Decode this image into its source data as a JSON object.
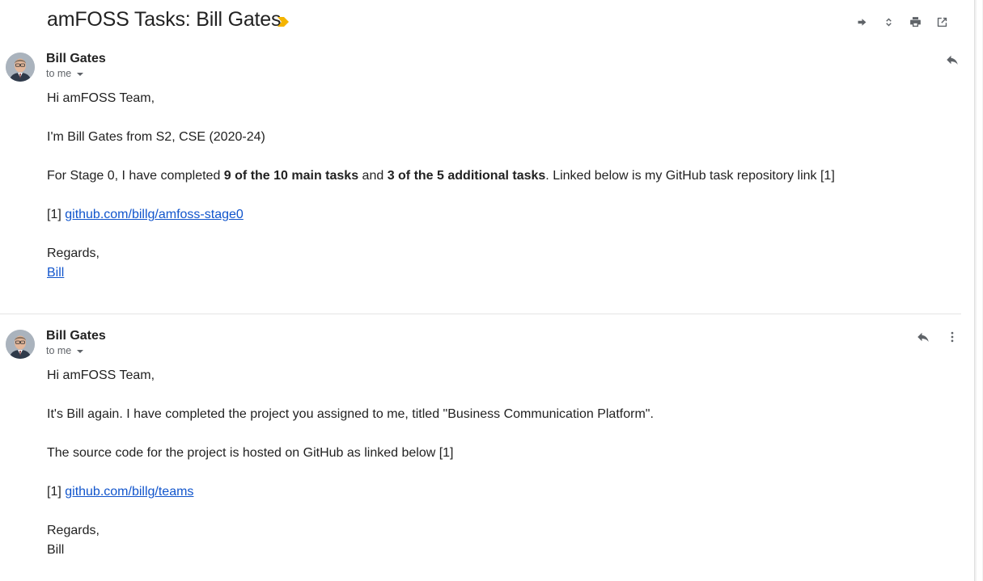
{
  "thread": {
    "subject": "amFOSS Tasks: Bill Gates",
    "importance_icon": "importance-marker-icon",
    "importance_color": "#f4b400"
  },
  "toolbar": {
    "icons": [
      "forward-icon",
      "expand-collapse-icon",
      "print-icon",
      "open-new-window-icon"
    ]
  },
  "messages": [
    {
      "sender": "Bill Gates",
      "recipient": "to me",
      "greeting": "Hi amFOSS Team,",
      "intro": "I'm Bill Gates from S2, CSE (2020-24)",
      "p2_a": "For Stage 0, I have completed ",
      "p2_b": "9 of the 10 main tasks",
      "p2_c": " and ",
      "p2_d": "3 of the 5 additional tasks",
      "p2_e": ". Linked below is my GitHub task repository link [1]",
      "ref_prefix": "[1] ",
      "ref_link": "github.com/billg/amfoss-stage0",
      "closing": "Regards,",
      "signature": "Bill"
    },
    {
      "sender": "Bill Gates",
      "recipient": "to me",
      "greeting": "Hi amFOSS Team,",
      "p1": "It's Bill again. I have completed the project you assigned to me, titled \"Business Communication Platform\".",
      "p2": "The source code for the project is hosted on GitHub as linked below [1]",
      "ref_prefix": "[1] ",
      "ref_link": "github.com/billg/teams",
      "closing": "Regards,",
      "signature": "Bill"
    }
  ],
  "colors": {
    "link": "#1155cc",
    "text": "#222222",
    "icon": "#5f6368"
  }
}
